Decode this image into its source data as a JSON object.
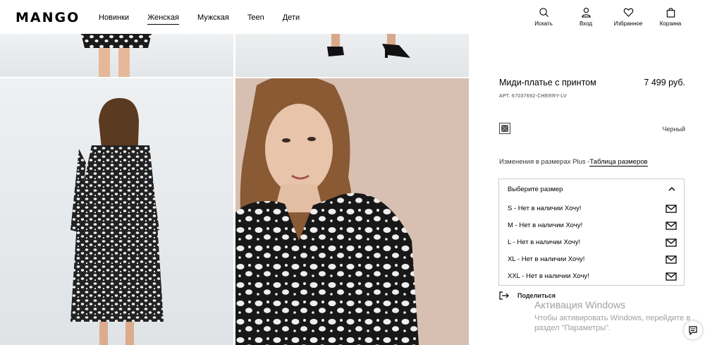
{
  "header": {
    "logo": "MANGO",
    "nav": [
      "Новинки",
      "Женская",
      "Мужская",
      "Teen",
      "Дети"
    ],
    "tools": [
      {
        "label": "Искать",
        "icon": "search-icon"
      },
      {
        "label": "Вход",
        "icon": "user-icon"
      },
      {
        "label": "Избранное",
        "icon": "heart-icon"
      },
      {
        "label": "Корзина",
        "icon": "bag-icon"
      }
    ]
  },
  "product": {
    "name": "Миди-платье с принтом",
    "price": "7 499 руб.",
    "article": "АРТ. 67037692-CHERRY-LV",
    "color_name": "Черный",
    "size_note": "Изменения в размерах Plus -",
    "size_table_link": "Таблица размеров",
    "size_select_label": "Выберите размер",
    "sizes": [
      "S - Нет в наличии Хочу!",
      "M - Нет в наличии Хочу!",
      "L - Нет в наличии Хочу!",
      "XL - Нет в наличии Хочу!",
      "XXL - Нет в наличии Хочу!"
    ],
    "share_label": "Поделиться"
  },
  "watermark": {
    "title": "Активация Windows",
    "line1": "Чтобы активировать Windows, перейдите в",
    "line2": "раздел \"Параметры\"."
  },
  "colors": {
    "accent": "#000000",
    "dress_dark": "#1a1a1a",
    "dress_light": "#f2f2f2"
  }
}
